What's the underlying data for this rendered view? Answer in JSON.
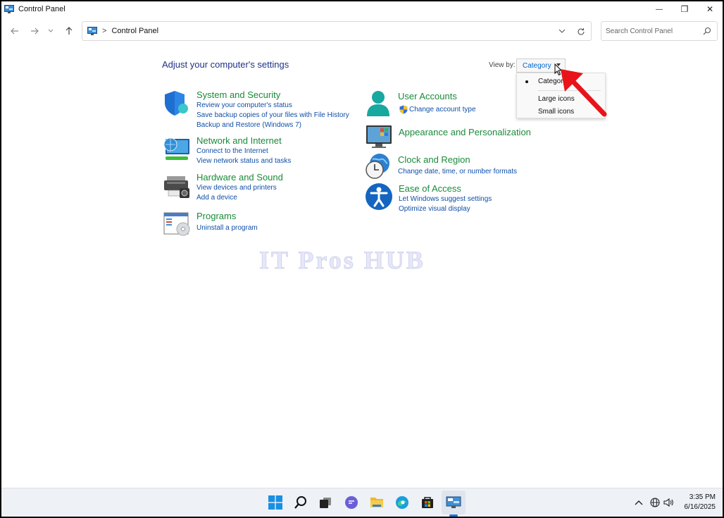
{
  "window": {
    "title": "Control Panel",
    "minimize_glyph": "—",
    "restore_glyph": "❐",
    "close_glyph": "✕"
  },
  "nav": {
    "breadcrumb_sep": ">",
    "breadcrumb": "Control Panel",
    "search_placeholder": "Search Control Panel"
  },
  "main": {
    "heading": "Adjust your computer's settings",
    "view_by_label": "View by:",
    "view_by_value": "Category"
  },
  "view_menu": {
    "items": [
      "Category",
      "Large icons",
      "Small icons"
    ],
    "selected_index": 0
  },
  "categories": [
    {
      "title": "System and Security",
      "links": [
        "Review your computer's status",
        "Save backup copies of your files with File History",
        "Backup and Restore (Windows 7)"
      ]
    },
    {
      "title": "Network and Internet",
      "links": [
        "Connect to the Internet",
        "View network status and tasks"
      ]
    },
    {
      "title": "Hardware and Sound",
      "links": [
        "View devices and printers",
        "Add a device"
      ]
    },
    {
      "title": "Programs",
      "links": [
        "Uninstall a program"
      ]
    },
    {
      "title": "User Accounts",
      "links": [
        "Change account type"
      ]
    },
    {
      "title": "Appearance and Personalization",
      "links": []
    },
    {
      "title": "Clock and Region",
      "links": [
        "Change date, time, or number formats"
      ]
    },
    {
      "title": "Ease of Access",
      "links": [
        "Let Windows suggest settings",
        "Optimize visual display"
      ]
    }
  ],
  "watermark": "IT Pros HUB",
  "taskbar": {
    "time": "3:35 PM",
    "date": "6/16/2025",
    "icons": [
      "start-icon",
      "search-icon",
      "task-view-icon",
      "teams-chat-icon",
      "file-explorer-icon",
      "edge-icon",
      "store-icon",
      "control-panel-icon"
    ]
  },
  "colors": {
    "category_title": "#1a8a3a",
    "link": "#0f4fa8",
    "heading": "#1e3287",
    "arrow": "#e8141a"
  }
}
